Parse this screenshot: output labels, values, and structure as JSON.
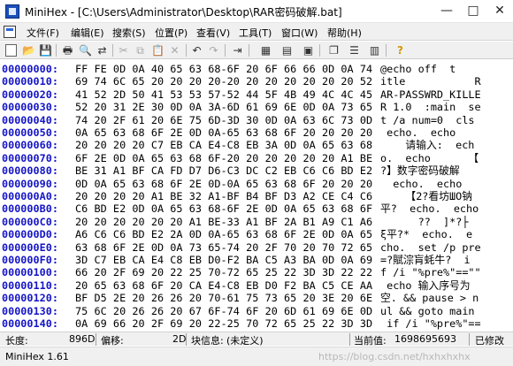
{
  "window": {
    "title": "MiniHex - [C:\\Users\\Administrator\\Desktop\\RAR密码破解.bat]",
    "min_glyph": "—",
    "max_glyph": "□",
    "close_glyph": "✕"
  },
  "menu": [
    "文件(F)",
    "编辑(E)",
    "搜索(S)",
    "位置(P)",
    "查看(V)",
    "工具(T)",
    "窗口(W)",
    "帮助(H)"
  ],
  "toolbar": {
    "new_icon": "new-file-icon",
    "open_icon": "open-folder-icon",
    "save_icon": "save-icon",
    "print_icon": "print-icon",
    "find_icon": "find-icon",
    "replace_icon": "replace-icon",
    "cut_icon": "cut-icon",
    "copy_icon": "copy-icon",
    "paste_icon": "paste-icon",
    "delete_icon": "delete-icon",
    "undo_icon": "undo-icon",
    "redo_icon": "redo-icon",
    "goto_icon": "goto-icon",
    "grid_icon": "grid-icon",
    "properties_icon": "properties-icon",
    "tile_icon": "tile-windows-icon",
    "cascade_icon": "cascade-windows-icon",
    "split_icon": "split-icon",
    "help_icon": "help-icon"
  },
  "rows": [
    {
      "addr": "00000000:",
      "hex": "FF FE 0D 0A 40 65 63 68-6F 20 6F 66 66 0D 0A 74",
      "ascii": "@echo off  t"
    },
    {
      "addr": "00000010:",
      "hex": "69 74 6C 65 20 20 20 20-20 20 20 20 20 20 20 52",
      "ascii": "itle           R"
    },
    {
      "addr": "00000020:",
      "hex": "41 52 2D 50 41 53 53 57-52 44 5F 4B 49 4C 4C 45",
      "ascii": "AR-PASSWRD_KILLE"
    },
    {
      "addr": "00000030:",
      "hex": "52 20 31 2E 30 0D 0A 3A-6D 61 69 6E 0D 0A 73 65",
      "ascii": "R 1.0  :main  se"
    },
    {
      "addr": "00000040:",
      "hex": "74 20 2F 61 20 6E 75 6D-3D 30 0D 0A 63 6C 73 0D",
      "ascii": "t /a num=0  cls "
    },
    {
      "addr": "00000050:",
      "hex": "0A 65 63 68 6F 2E 0D 0A-65 63 68 6F 20 20 20 20",
      "ascii": " echo.  echo"
    },
    {
      "addr": "00000060:",
      "hex": "20 20 20 20 C7 EB CA E4-C8 EB 3A 0D 0A 65 63 68",
      "ascii": "    请输入:  ech"
    },
    {
      "addr": "00000070:",
      "hex": "6F 2E 0D 0A 65 63 68 6F-20 20 20 20 20 20 A1 BE",
      "ascii": "o.  echo      【"
    },
    {
      "addr": "00000080:",
      "hex": "BE 31 A1 BF CA FD D7 D6-C3 DC C2 EB C6 C6 BD E2",
      "ascii": "?】数字密码破解"
    },
    {
      "addr": "00000090:",
      "hex": "0D 0A 65 63 68 6F 2E 0D-0A 65 63 68 6F 20 20 20",
      "ascii": "  echo.  echo"
    },
    {
      "addr": "000000A0:",
      "hex": "20 20 20 20 A1 BE 32 A1-BF B4 BF D3 A2 CE C4 C6",
      "ascii": "    【2?看坊ШО钠"
    },
    {
      "addr": "000000B0:",
      "hex": "C6 BD E2 0D 0A 65 63 68-6F 2E 0D 0A 65 63 68 6F",
      "ascii": "平?  echo.  echo"
    },
    {
      "addr": "000000C0:",
      "hex": "20 20 20 20 20 20 A1 BE-33 A1 BF 2A B1 A9 C1 A6",
      "ascii": "      ??  ]*?├"
    },
    {
      "addr": "000000D0:",
      "hex": "A6 C6 C6 BD E2 2A 0D 0A-65 63 68 6F 2E 0D 0A 65",
      "ascii": "ξ平?*  echo.  e"
    },
    {
      "addr": "000000E0:",
      "hex": "63 68 6F 2E 0D 0A 73 65-74 20 2F 70 20 70 72 65",
      "ascii": "cho.  set /p pre"
    },
    {
      "addr": "000000F0:",
      "hex": "3D C7 EB CA E4 C8 EB D0-F2 BA C5 A3 BA 0D 0A 69",
      "ascii": "=?賦淙肓蚝牛?  i"
    },
    {
      "addr": "00000100:",
      "hex": "66 20 2F 69 20 22 25 70-72 65 25 22 3D 3D 22 22",
      "ascii": "f /i \"%pre%\"==\"\""
    },
    {
      "addr": "00000110:",
      "hex": "20 65 63 68 6F 20 CA E4-C8 EB D0 F2 BA C5 CE AA",
      "ascii": " echo 输入序号为"
    },
    {
      "addr": "00000120:",
      "hex": "BF D5 2E 20 26 26 20 70-61 75 73 65 20 3E 20 6E",
      "ascii": "空. && pause > n"
    },
    {
      "addr": "00000130:",
      "hex": "75 6C 20 26 26 20 67 6F-74 6F 20 6D 61 69 6E 0D",
      "ascii": "ul && goto main "
    },
    {
      "addr": "00000140:",
      "hex": "0A 69 66 20 2F 69 20 22-25 70 72 65 25 22 3D 3D",
      "ascii": " if /i \"%pre%\"=="
    }
  ],
  "status": {
    "length_label": "长度:",
    "length_value": "896D",
    "offset_label": "偏移:",
    "offset_value": "2D",
    "block_label": "块信息:",
    "block_value": "(未定义)",
    "current_label": "当前值:",
    "current_value": "1698695693",
    "modified": "已修改"
  },
  "footer": {
    "version": "MiniHex 1.61",
    "watermark": "https://blog.csdn.net/hxhxhxhx"
  }
}
